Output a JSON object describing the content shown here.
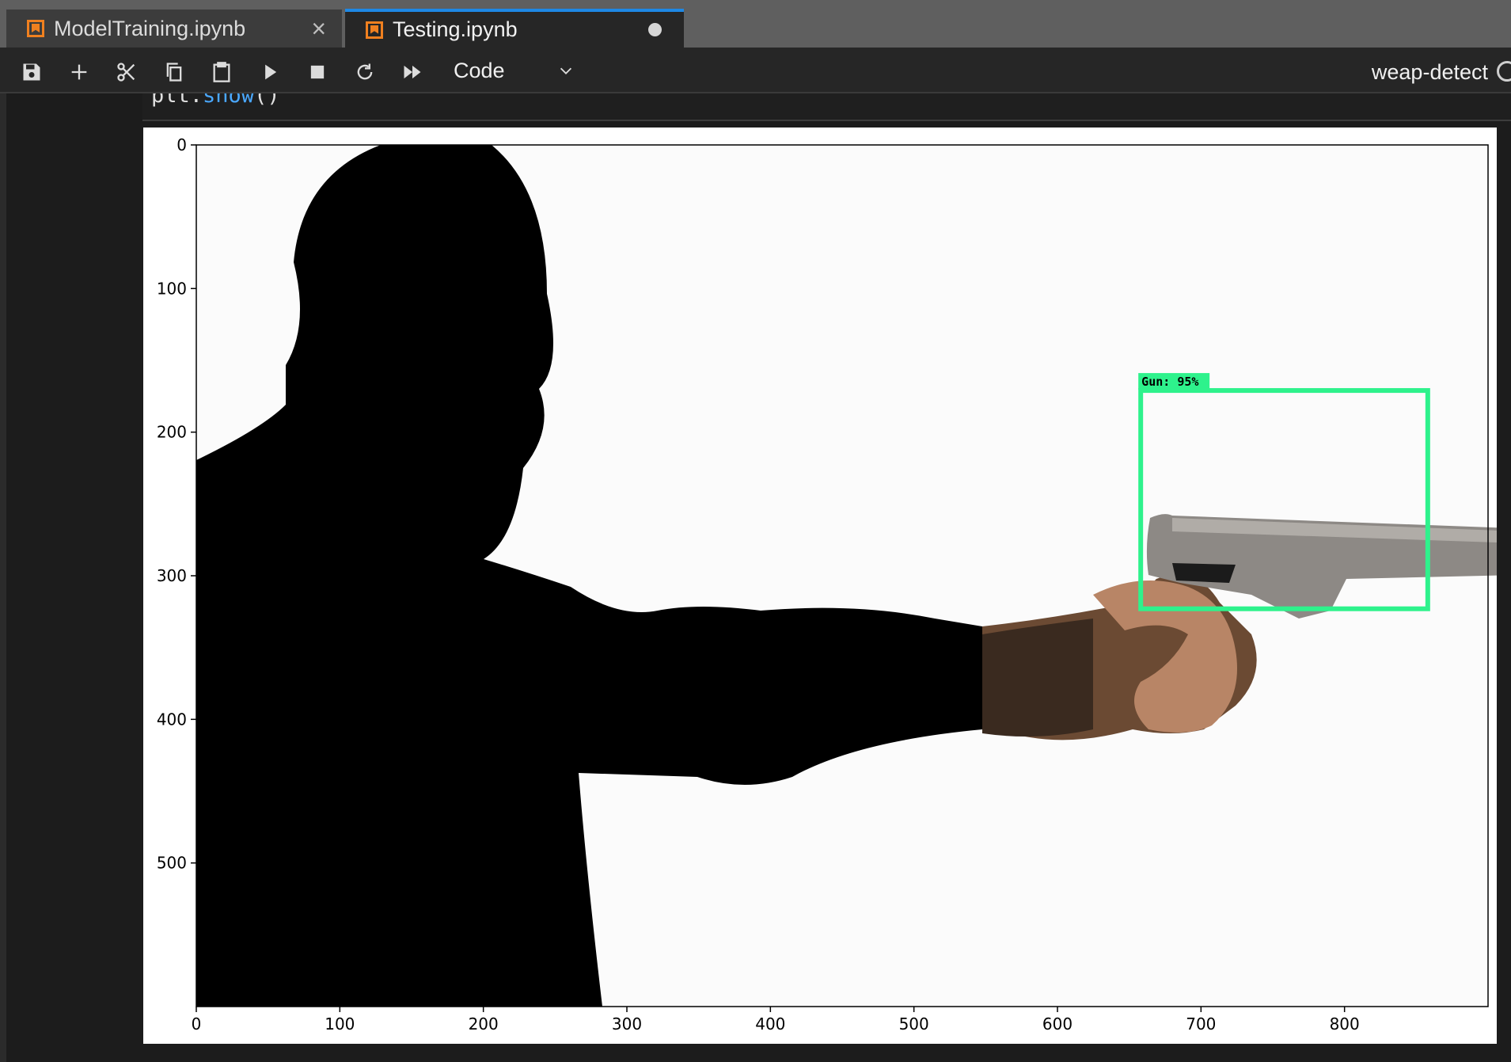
{
  "tabs": [
    {
      "label": "ModelTraining.ipynb",
      "icon": "notebook-icon",
      "active": false,
      "indicator": "close"
    },
    {
      "label": "Testing.ipynb",
      "icon": "notebook-icon",
      "active": true,
      "indicator": "unsaved-dot"
    }
  ],
  "toolbar": {
    "buttons": [
      "save-icon",
      "add-cell-icon",
      "cut-icon",
      "copy-icon",
      "paste-icon",
      "run-icon",
      "stop-icon",
      "restart-icon",
      "run-all-icon"
    ],
    "cell_type": "Code",
    "kernel": "weap-detect"
  },
  "code": {
    "object": "plt.",
    "function": "show",
    "rest": "()"
  },
  "detection": {
    "label": "Gun: 95%",
    "class": "Gun",
    "confidence": 0.95,
    "box_color": "#2ef28c",
    "bbox_data": {
      "x0": 658,
      "y0": 171,
      "x1": 858,
      "y1": 323
    }
  },
  "chart_data": {
    "type": "image",
    "xlim": [
      0,
      900
    ],
    "ylim": [
      600,
      0
    ],
    "xticks": [
      0,
      100,
      200,
      300,
      400,
      500,
      600,
      700,
      800
    ],
    "yticks": [
      0,
      100,
      200,
      300,
      400,
      500
    ]
  },
  "colors": {
    "tab_accent": "#1e88e5",
    "notebook_icon": "#f0801f",
    "code_function": "#4aa8ff"
  }
}
